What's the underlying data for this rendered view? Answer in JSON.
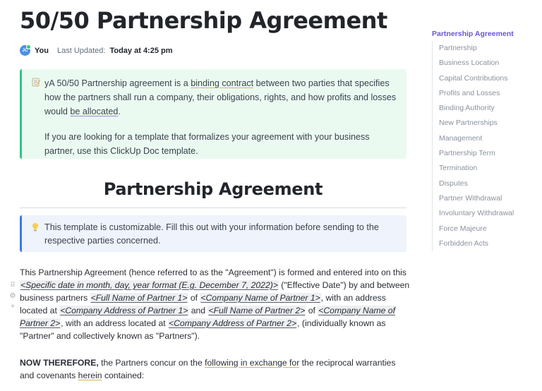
{
  "title": "50/50 Partnership Agreement",
  "meta": {
    "avatar_initials": "JC",
    "user": "You",
    "updated_label": "Last Updated:",
    "updated_value": "Today at 4:25 pm"
  },
  "intro_callout": {
    "emoji": "memo-icon",
    "p1_prefix": "yA 50/50 Partnership agreement is a ",
    "p1_link": "binding contract",
    "p1_middle": " between two parties that specifies how the partners shall run a company, their obligations, rights, and how profits and losses would ",
    "p1_link2": "be allocated",
    "p1_suffix": ".",
    "p2": "If you are looking for a template that formalizes your agreement with your business partner, use this ClickUp Doc template."
  },
  "section_heading": "Partnership Agreement",
  "tip_callout": {
    "emoji": "lightbulb-icon",
    "text": "This template is customizable. Fill this out with your information before sending to the respective parties concerned."
  },
  "agreement_para": {
    "t1": "This Partnership Agreement (hence referred to as the \"Agreement\") is formed and entered into on this ",
    "m_date": "<Specific date in month, day, year format (E.g. December 7, 2022)>",
    "t2": " (\"Effective Date\") by and between business partners ",
    "m_name1": "<Full Name of Partner 1>",
    "t3": " of ",
    "m_company1": "<Company Name of Partner 1>",
    "t4": ", with an address located at ",
    "m_address1": "<Company Address of Partner 1>",
    "t5": " and ",
    "m_name2": "<Full Name of Partner 2>",
    "t6": " of ",
    "m_company2": "<Company Name of Partner 2>",
    "t7": ", with an address located at ",
    "m_address2": "<Company Address of Partner 2>",
    "t8": ", (individually known as \"Partner\" and collectively known as \"Partners\")."
  },
  "now_para": {
    "bold": "NOW THEREFORE,",
    "t1": " the Partners concur on the ",
    "link1": "following in exchange for",
    "t2": " the reciprocal warranties and covenants ",
    "link2": "herein",
    "t3": " contained:"
  },
  "gutter": {
    "drag_icon": "⠿",
    "settings_icon": "⚙",
    "add_icon": "+"
  },
  "toc": {
    "title": "Partnership Agreement",
    "items": [
      "Partnership",
      "Business Location",
      "Capital Contributions",
      "Profits and Losses",
      "Binding Authority",
      "New Partnerships",
      "Management",
      "Partnership Term",
      "Termination",
      "Disputes",
      "Partner Withdrawal",
      "Involuntary Withdrawal",
      "Force Majeure",
      "Forbidden Acts"
    ]
  },
  "colors": {
    "toc_active": "#6a55d6",
    "green_callout_bg": "#eafaf1",
    "green_callout_border": "#2ec486",
    "blue_callout_bg": "#eef3fc",
    "blue_callout_border": "#3a7be0"
  }
}
